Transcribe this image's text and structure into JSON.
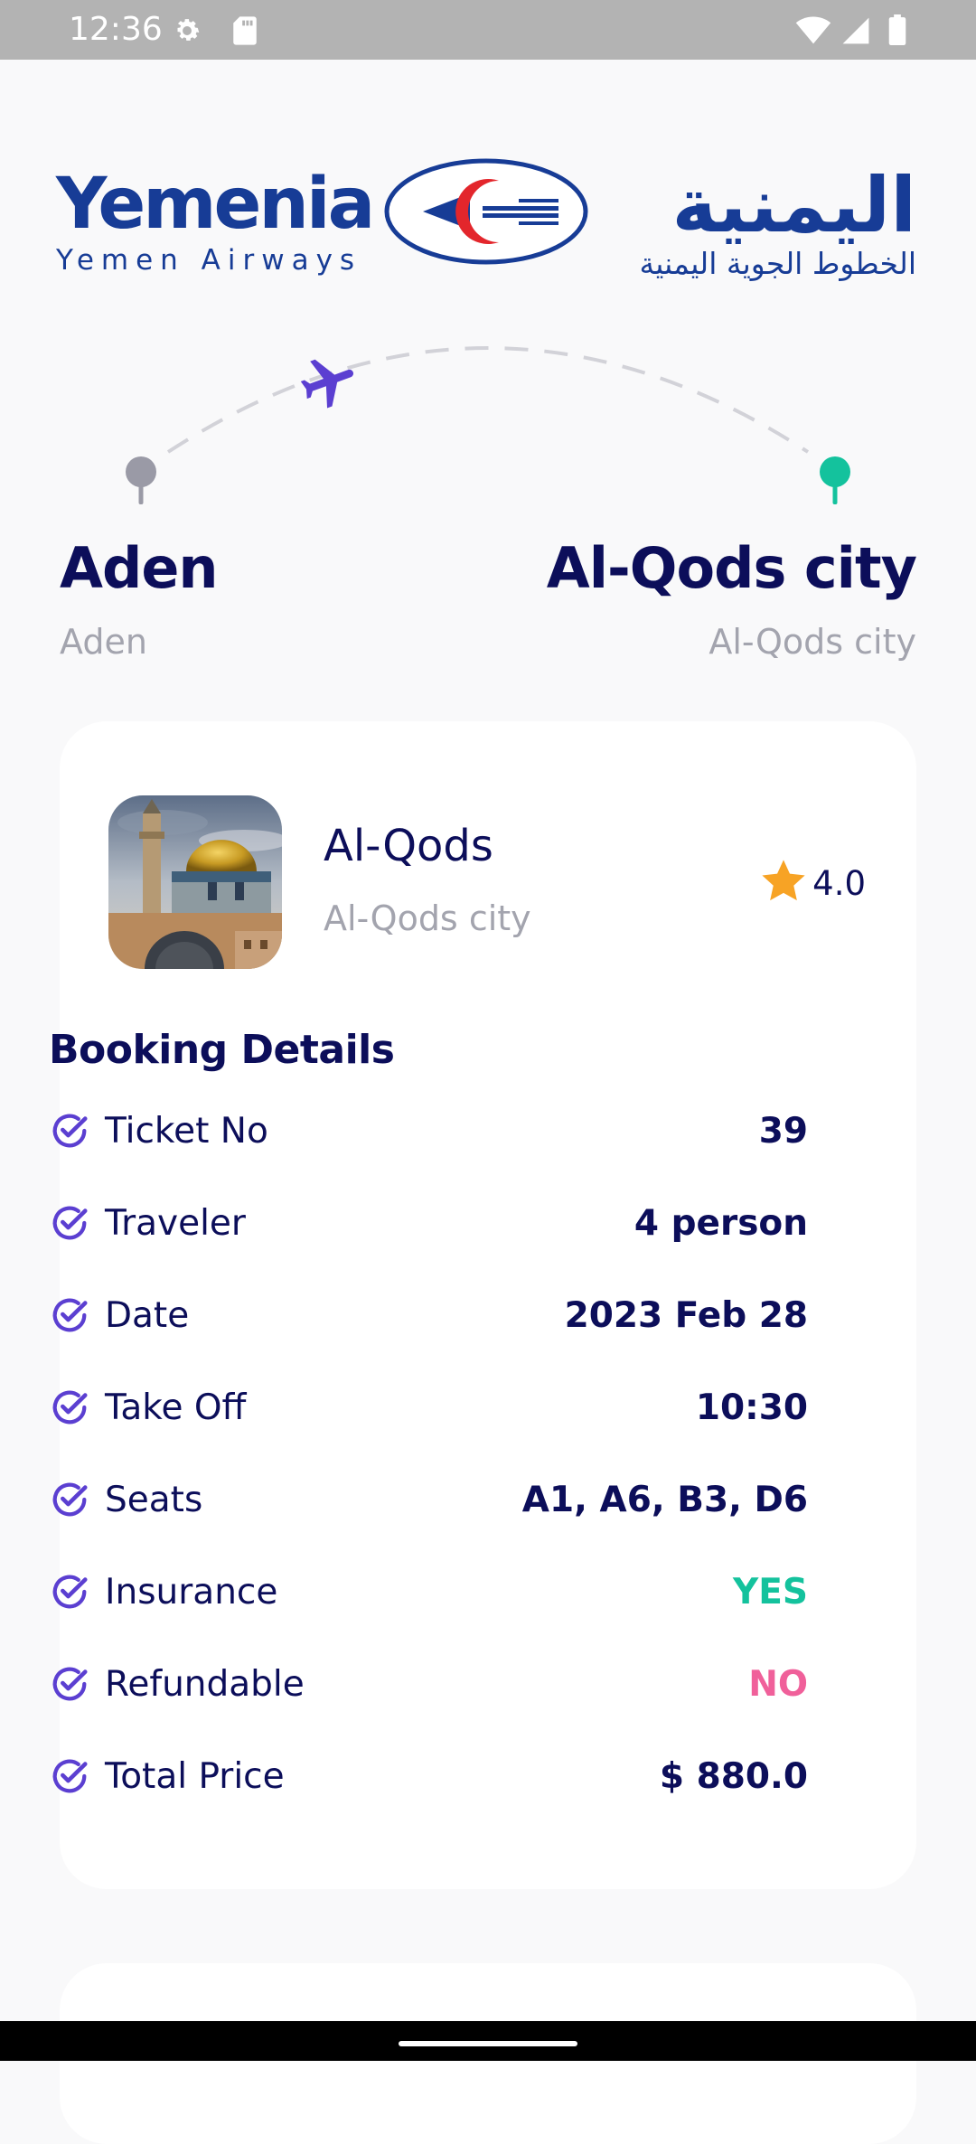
{
  "status_bar": {
    "time": "12:36"
  },
  "header": {
    "logo_en_title": "Yemenia",
    "logo_en_sub": "Yemen Airways",
    "logo_ar_title": "اليمنية",
    "logo_ar_sub": "الخطوط الجوية اليمنية"
  },
  "route": {
    "origin": {
      "city": "Aden",
      "subtitle": "Aden"
    },
    "destination": {
      "city": "Al-Qods city",
      "subtitle": "Al-Qods city"
    }
  },
  "destination_card": {
    "name": "Al-Qods",
    "city": "Al-Qods city",
    "rating": "4.0"
  },
  "booking": {
    "title": "Booking Details",
    "rows": [
      {
        "label": "Ticket No",
        "value": "39"
      },
      {
        "label": "Traveler",
        "value": "4 person"
      },
      {
        "label": "Date",
        "value": "2023 Feb 28"
      },
      {
        "label": "Take Off",
        "value": "10:30"
      },
      {
        "label": "Seats",
        "value": "A1, A6, B3, D6"
      },
      {
        "label": "Insurance",
        "value": "YES"
      },
      {
        "label": "Refundable",
        "value": "NO"
      },
      {
        "label": "Total Price",
        "value": "$ 880.0"
      }
    ]
  },
  "colors": {
    "accent": "#5b3fd1",
    "primary_text": "#0c0e5a",
    "muted_text": "#a3a4ae",
    "yes": "#14c29d",
    "no": "#f0609a",
    "origin_pin": "#9a9aa6",
    "destination_pin": "#14c29d",
    "star": "#f7a325",
    "brand": "#173c96"
  }
}
